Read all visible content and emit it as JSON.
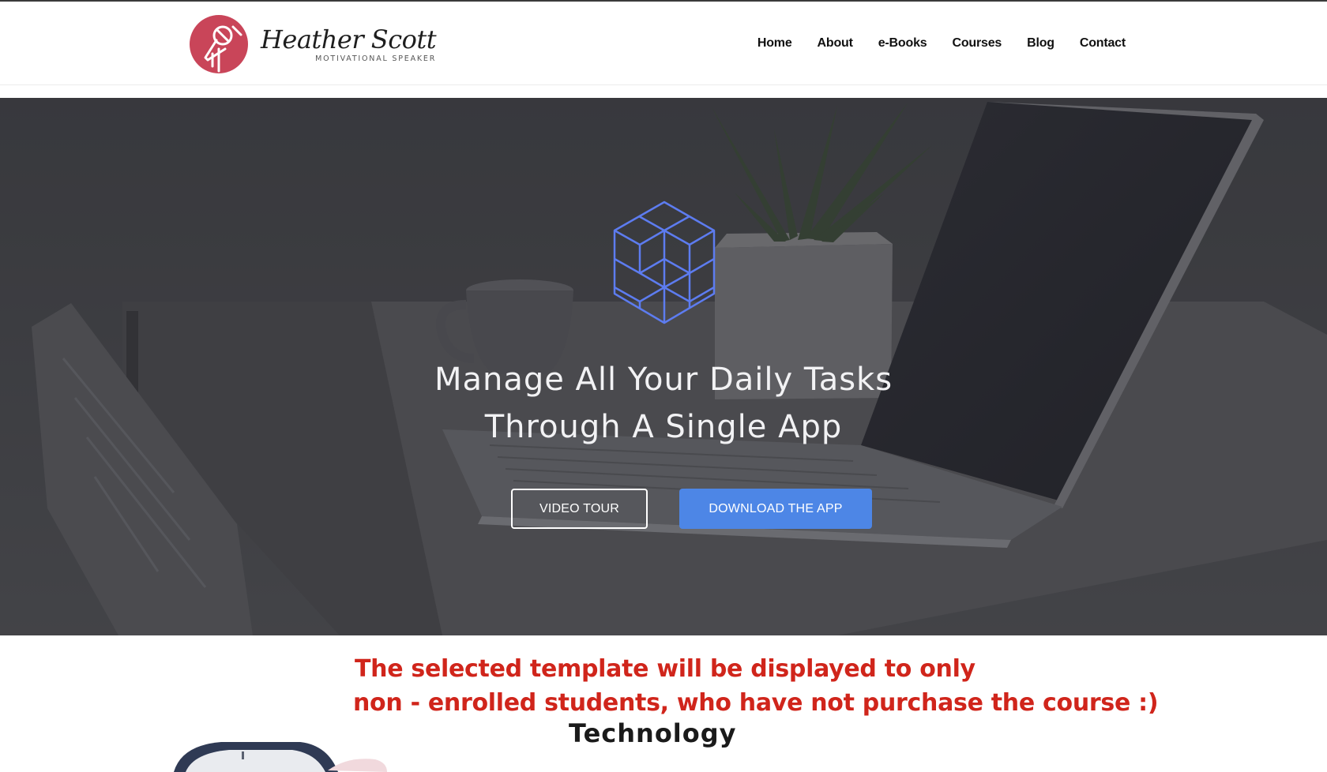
{
  "header": {
    "brand_name": "Heather Scott",
    "brand_tagline": "MOTIVATIONAL SPEAKER",
    "logo_icon": "microphone-logo-icon",
    "logo_color": "#c94559"
  },
  "nav": {
    "items": [
      {
        "label": "Home"
      },
      {
        "label": "About"
      },
      {
        "label": "e-Books"
      },
      {
        "label": "Courses"
      },
      {
        "label": "Blog"
      },
      {
        "label": "Contact"
      }
    ]
  },
  "hero": {
    "icon": "cube-stack-icon",
    "icon_color": "#5d7cf0",
    "title_line1": "Manage All Your Daily Tasks",
    "title_line2": "Through A Single App",
    "video_button": "VIDEO TOUR",
    "download_button": "DOWNLOAD THE APP",
    "accent_color": "#4d86e6"
  },
  "notice": {
    "line1": "The selected template will be displayed to only",
    "line2": "non - enrolled students, who have not purchase the course :)",
    "color": "#d0251b"
  },
  "section": {
    "title": "Technology"
  }
}
